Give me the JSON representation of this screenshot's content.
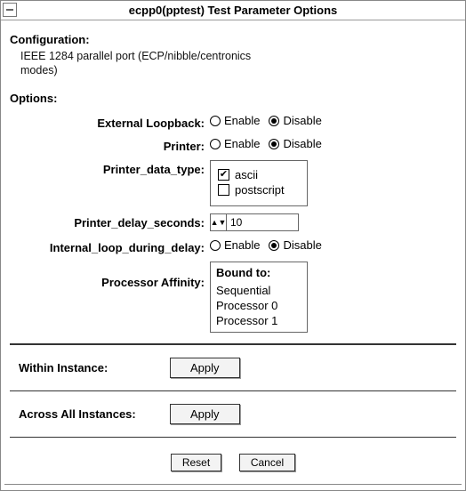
{
  "window": {
    "title": "ecpp0(pptest) Test Parameter Options"
  },
  "labels": {
    "configuration": "Configuration:",
    "config_text": "IEEE 1284 parallel port (ECP/nibble/centronics modes)",
    "options": "Options:",
    "external_loopback": "External Loopback:",
    "printer": "Printer:",
    "printer_data_type": "Printer_data_type:",
    "printer_delay_seconds": "Printer_delay_seconds:",
    "internal_loop": "Internal_loop_during_delay:",
    "processor_affinity": "Processor Affinity:",
    "within_instance": "Within Instance:",
    "across_all_instances": "Across All Instances:"
  },
  "radio": {
    "enable": "Enable",
    "disable": "Disable"
  },
  "data_type": {
    "ascii": "ascii",
    "postscript": "postscript"
  },
  "delay": {
    "value": "10"
  },
  "affinity": {
    "header": "Bound to:",
    "items": [
      "Sequential",
      "Processor 0",
      "Processor 1"
    ]
  },
  "buttons": {
    "apply": "Apply",
    "reset": "Reset",
    "cancel": "Cancel"
  }
}
